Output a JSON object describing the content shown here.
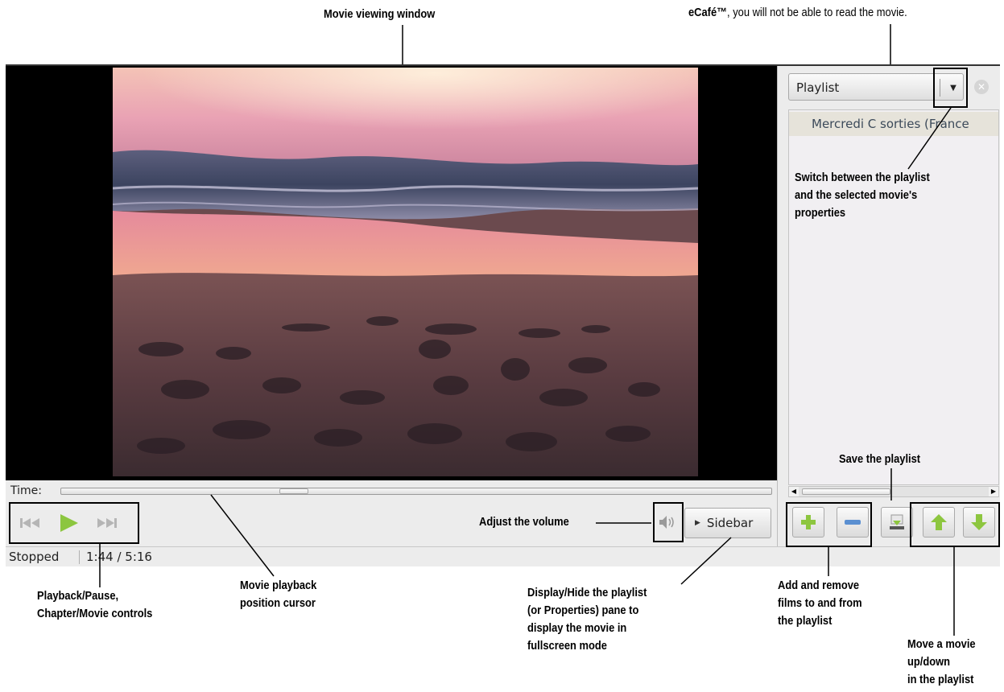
{
  "annotations": {
    "movie_window": "Movie viewing window",
    "ecafe_note_brand": "eCafé™",
    "ecafe_note_rest": ", you will not be able to read the movie.",
    "switch_line1": "Switch between the playlist",
    "switch_line2": "and the selected movie's",
    "switch_line3": "properties",
    "save_playlist": "Save the playlist",
    "adjust_volume": "Adjust the volume",
    "playback_line1": "Playback/Pause,",
    "playback_line2": "Chapter/Movie controls",
    "cursor_line1": "Movie playback",
    "cursor_line2": "position cursor",
    "display_line1": "Display/Hide the playlist",
    "display_line2": "(or Properties) pane to",
    "display_line3": "display the movie in",
    "display_line4": "fullscreen mode",
    "add_line1": "Add and remove",
    "add_line2": "films to and from",
    "add_line3": "the playlist",
    "move_line1": "Move a movie",
    "move_line2": "up/down",
    "move_line3": "in the playlist"
  },
  "player": {
    "time_label": "Time:",
    "position_fraction": 0.32,
    "sidebar_label": "Sidebar",
    "status": "Stopped",
    "time_display": "1:44 / 5:16"
  },
  "playlist": {
    "combo_value": "Playlist",
    "items": [
      "Mercredi C sorties (France"
    ]
  },
  "icons": {
    "previous": "skip-back-icon",
    "play": "play-icon",
    "next": "skip-forward-icon",
    "volume": "speaker-icon",
    "close": "close-circle-icon",
    "add": "plus-icon",
    "remove": "minus-icon",
    "save": "save-icon",
    "up": "arrow-up-icon",
    "down": "arrow-down-icon"
  },
  "colors": {
    "play_green": "#8cc63f",
    "button_green": "#8dc63f",
    "remove_blue": "#5a8fd1"
  }
}
